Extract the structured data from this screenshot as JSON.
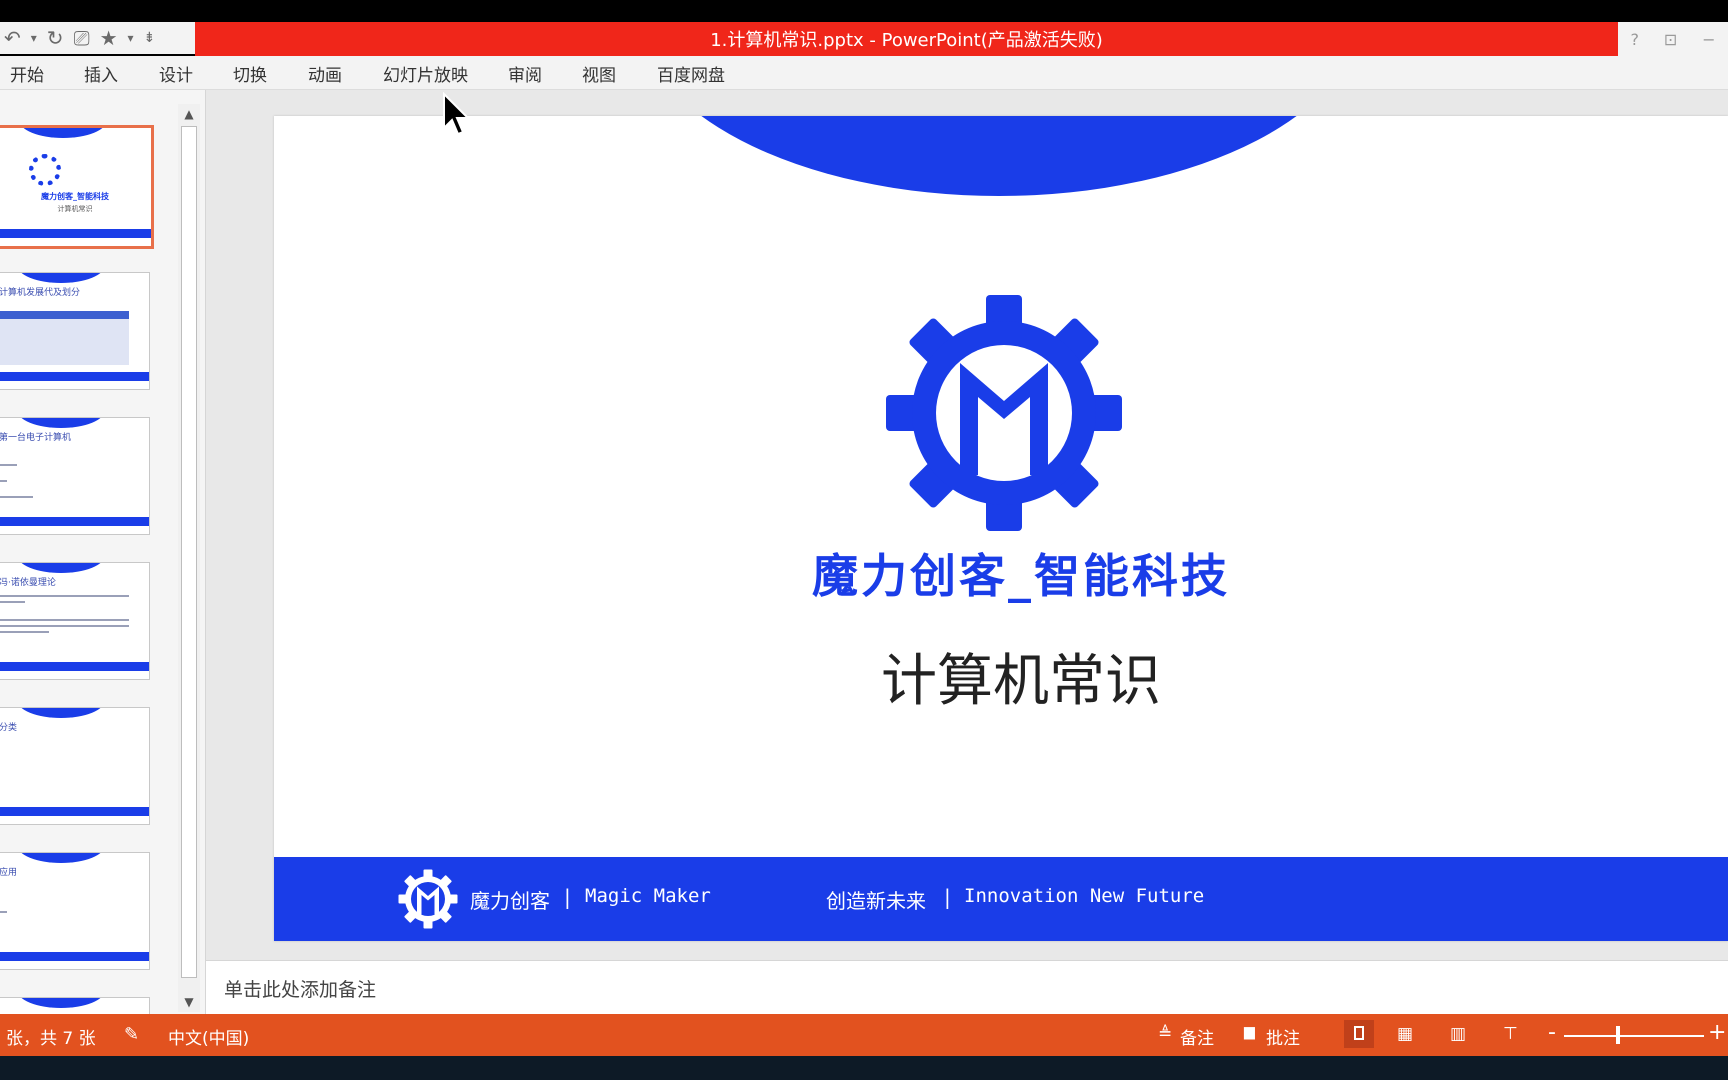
{
  "window": {
    "title": "1.计算机常识.pptx -  PowerPoint(产品激活失败)",
    "help_label": "?",
    "options_label": "⊡"
  },
  "qat": {
    "undo_icon": "↶",
    "undo_dropdown": "▾",
    "redo_icon": "↻",
    "slideshow_icon": "⎚",
    "star_icon": "★",
    "star_dropdown": "▾",
    "customize": "⇟"
  },
  "ribbon": {
    "tabs": [
      "开始",
      "插入",
      "设计",
      "切换",
      "动画",
      "幻灯片放映",
      "审阅",
      "视图",
      "百度网盘"
    ]
  },
  "thumbnails": [
    {
      "title": "魔力创客_智能科技",
      "sub": "计算机常识"
    },
    {
      "title": "计算机发展代及划分"
    },
    {
      "title": "第一台电子计算机"
    },
    {
      "title": "冯·诺依曼理论"
    },
    {
      "title": "分类"
    },
    {
      "title": "应用"
    }
  ],
  "slide": {
    "brand": "魔力创客_智能科技",
    "subtitle": "计算机常识",
    "footer_left": "魔力创客",
    "footer_sep": "|",
    "footer_left_en": "Magic Maker",
    "footer_right": "创造新未来",
    "footer_right_en": "Innovation New Future"
  },
  "notes": {
    "placeholder": "单击此处添加备注"
  },
  "status": {
    "slide_info": "张，共 7 张",
    "language": "中文(中国)",
    "notes_label": "备注",
    "comments_label": "批注",
    "zoom_minus": "-",
    "zoom_plus": "+",
    "notes_icon": "≜",
    "comments_icon": "▆"
  },
  "colors": {
    "accent": "#1a3de8",
    "titlebar": "#f0261a",
    "statusbar": "#e2521f"
  }
}
